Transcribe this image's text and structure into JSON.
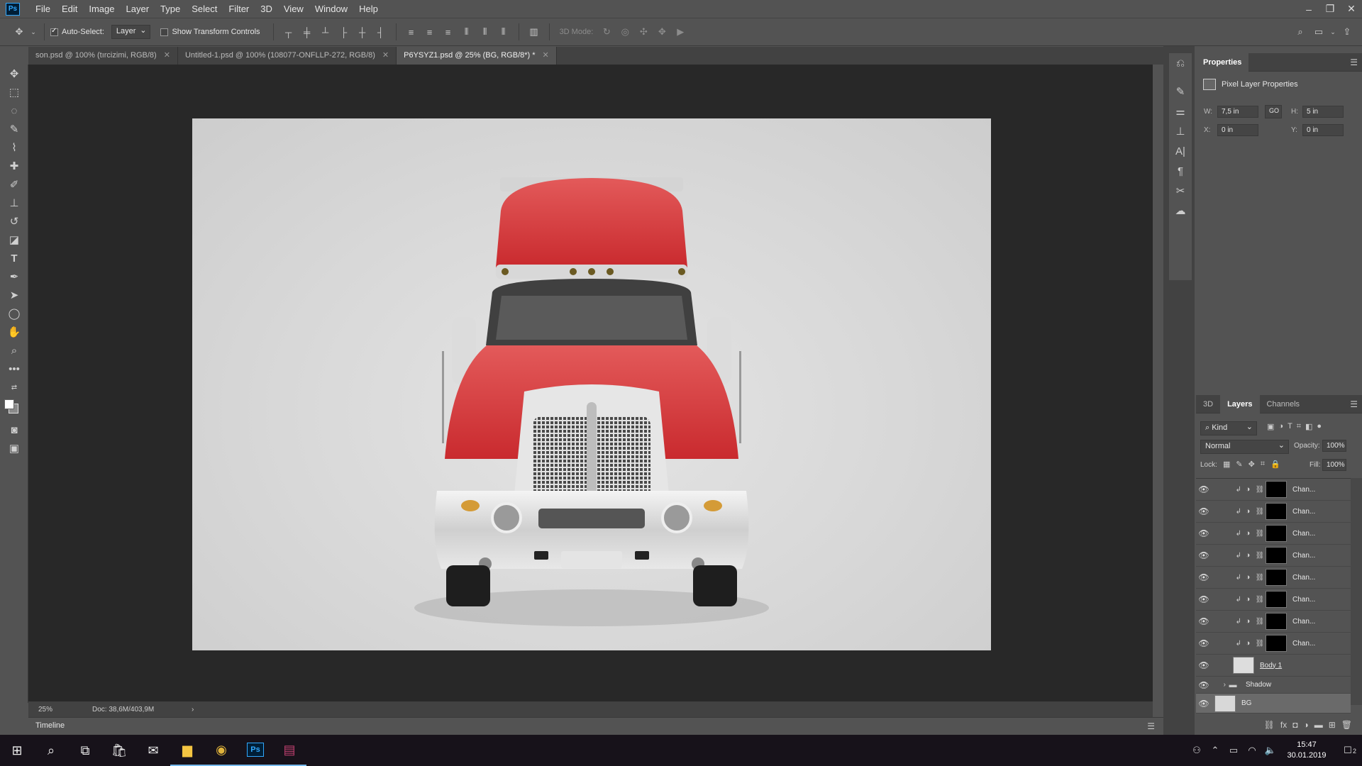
{
  "app": {
    "logo": "Ps",
    "accent": "#31a8ff"
  },
  "menu": [
    "File",
    "Edit",
    "Image",
    "Layer",
    "Type",
    "Select",
    "Filter",
    "3D",
    "View",
    "Window",
    "Help"
  ],
  "window_controls": [
    "minimize-icon",
    "restore-icon",
    "close-icon"
  ],
  "options": {
    "auto_select_label": "Auto-Select:",
    "auto_select_checked": true,
    "auto_select_value": "Layer",
    "transform_label": "Show Transform Controls",
    "transform_checked": false,
    "mode_3d_label": "3D Mode:"
  },
  "tabs": [
    {
      "label": "son.psd @ 100% (tırcizimi, RGB/8)",
      "active": false
    },
    {
      "label": "Untitled-1.psd @ 100% (108077-ONFLLP-272, RGB/8)",
      "active": false
    },
    {
      "label": "P6YSYZ1.psd @ 25% (BG, RGB/8*) *",
      "active": true
    }
  ],
  "status": {
    "zoom": "25%",
    "doc": "Doc: 38,6M/403,9M"
  },
  "timeline": {
    "label": "Timeline"
  },
  "properties": {
    "tab": "Properties",
    "title": "Pixel Layer Properties",
    "w_label": "W:",
    "w_value": "7,5 in",
    "h_label": "H:",
    "h_value": "5 in",
    "x_label": "X:",
    "x_value": "0 in",
    "y_label": "Y:",
    "y_value": "0 in",
    "link_label": "GO"
  },
  "layers": {
    "tabs": [
      "3D",
      "Layers",
      "Channels"
    ],
    "active_tab": "Layers",
    "kind": "Kind",
    "blend_mode": "Normal",
    "opacity_label": "Opacity:",
    "opacity_value": "100%",
    "lock_label": "Lock:",
    "fill_label": "Fill:",
    "fill_value": "100%",
    "rows": [
      {
        "name": "Chan..."
      },
      {
        "name": "Chan..."
      },
      {
        "name": "Chan..."
      },
      {
        "name": "Chan..."
      },
      {
        "name": "Chan..."
      },
      {
        "name": "Chan..."
      },
      {
        "name": "Chan..."
      },
      {
        "name": "Chan..."
      }
    ],
    "body_layer": "Body 1",
    "shadow_group": "Shadow",
    "bg_layer": "BG"
  },
  "taskbar": {
    "time": "15:47",
    "date": "30.01.2019",
    "notifications": "2"
  }
}
